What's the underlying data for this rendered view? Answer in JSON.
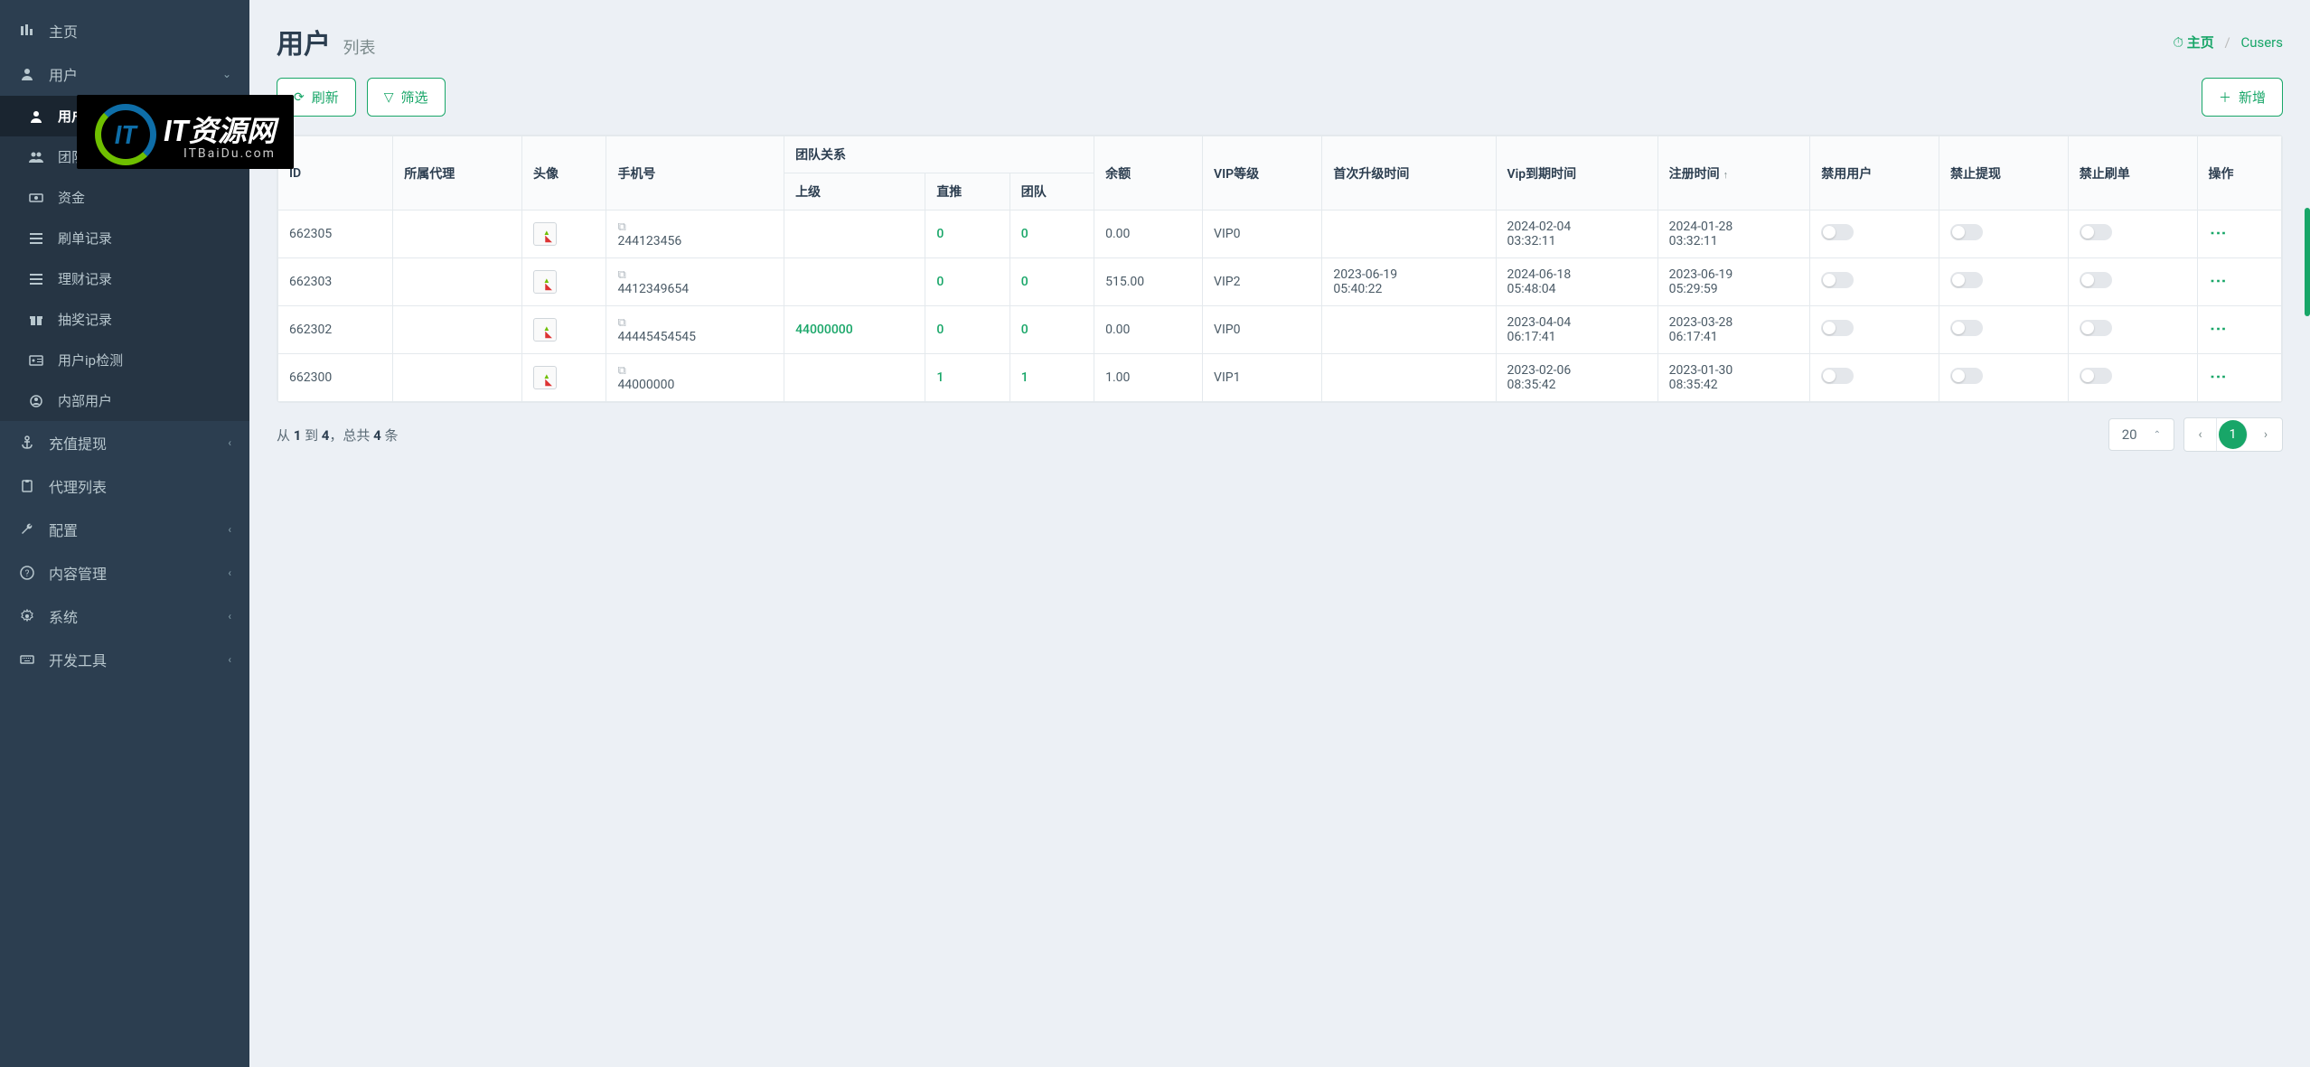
{
  "sidebar": {
    "items": [
      {
        "icon": "bars",
        "label": "主页"
      },
      {
        "icon": "user",
        "label": "用户",
        "expanded": true,
        "children": [
          {
            "icon": "user",
            "label": "用户",
            "active": true
          },
          {
            "icon": "users",
            "label": "团队"
          },
          {
            "icon": "money",
            "label": "资金"
          },
          {
            "icon": "list",
            "label": "刷单记录"
          },
          {
            "icon": "list",
            "label": "理财记录"
          },
          {
            "icon": "gift",
            "label": "抽奖记录"
          },
          {
            "icon": "id",
            "label": "用户ip检测"
          },
          {
            "icon": "person",
            "label": "内部用户"
          }
        ]
      },
      {
        "icon": "anchor",
        "label": "充值提现",
        "chevron": true
      },
      {
        "icon": "clipboard",
        "label": "代理列表"
      },
      {
        "icon": "wrench",
        "label": "配置",
        "chevron": true
      },
      {
        "icon": "help",
        "label": "内容管理",
        "chevron": true
      },
      {
        "icon": "gear",
        "label": "系统",
        "chevron": true
      },
      {
        "icon": "keyboard",
        "label": "开发工具",
        "chevron": true
      }
    ]
  },
  "watermark": {
    "logo": "IT",
    "main": "IT资源网",
    "sub": "ITBaiDu.com"
  },
  "page": {
    "title": "用户",
    "subtitle": "列表",
    "breadcrumb_home": "主页",
    "breadcrumb_page": "Cusers"
  },
  "toolbar": {
    "refresh": "刷新",
    "filter": "筛选",
    "add": "新增"
  },
  "table": {
    "headers": {
      "id": "ID",
      "first_name": "所属代理",
      "avatar": "头像",
      "phone": "手机号",
      "team_group": "团队关系",
      "parent": "上级",
      "direct": "直推",
      "team": "团队",
      "balance": "余额",
      "vip": "VIP等级",
      "first_upgrade": "首次升级时间",
      "vip_expire": "Vip到期时间",
      "reg_time": "注册时间",
      "ban_user": "禁用用户",
      "ban_withdraw": "禁止提现",
      "ban_order": "禁止刷单",
      "op": "操作"
    },
    "rows": [
      {
        "id": "662305",
        "phone": "244123456",
        "parent": "",
        "direct": "0",
        "team": "0",
        "balance": "0.00",
        "vip": "VIP0",
        "first_upgrade": "",
        "vip_expire": "2024-02-04 03:32:11",
        "reg_time": "2024-01-28 03:32:11"
      },
      {
        "id": "662303",
        "phone": "4412349654",
        "parent": "",
        "direct": "0",
        "team": "0",
        "balance": "515.00",
        "vip": "VIP2",
        "first_upgrade": "2023-06-19 05:40:22",
        "vip_expire": "2024-06-18 05:48:04",
        "reg_time": "2023-06-19 05:29:59"
      },
      {
        "id": "662302",
        "phone": "44445454545",
        "parent": "44000000",
        "direct": "0",
        "team": "0",
        "balance": "0.00",
        "vip": "VIP0",
        "first_upgrade": "",
        "vip_expire": "2023-04-04 06:17:41",
        "reg_time": "2023-03-28 06:17:41"
      },
      {
        "id": "662300",
        "phone": "44000000",
        "parent": "",
        "direct": "1",
        "team": "1",
        "balance": "1.00",
        "vip": "VIP1",
        "first_upgrade": "",
        "vip_expire": "2023-02-06 08:35:42",
        "reg_time": "2023-01-30 08:35:42"
      }
    ]
  },
  "pagination": {
    "summary_prefix": "从 ",
    "from": "1",
    "summary_mid": " 到 ",
    "to": "4",
    "summary_sep": "，总共 ",
    "total": "4",
    "summary_suffix": " 条",
    "page_size": "20",
    "current": "1"
  }
}
